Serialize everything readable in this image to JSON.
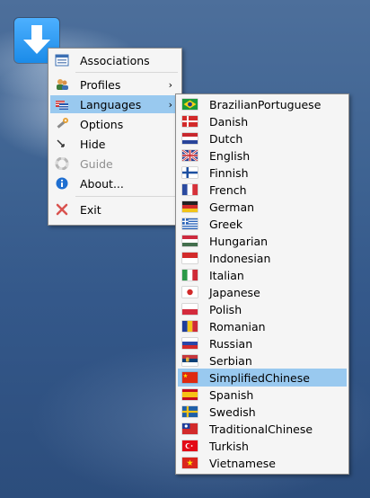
{
  "app_icon": {
    "name": "download-arrow-icon"
  },
  "main_menu": {
    "items": [
      {
        "label": "Associations",
        "icon": "associations-icon"
      },
      {
        "label": "Profiles",
        "icon": "profiles-icon"
      },
      {
        "label": "Languages",
        "icon": "languages-icon"
      },
      {
        "label": "Options",
        "icon": "wrench-icon"
      },
      {
        "label": "Hide",
        "icon": "hide-icon"
      },
      {
        "label": "Guide",
        "icon": "lifebuoy-icon"
      },
      {
        "label": "About...",
        "icon": "info-icon"
      },
      {
        "label": "Exit",
        "icon": "close-icon"
      }
    ]
  },
  "language_menu": {
    "items": [
      {
        "label": "BrazilianPortuguese"
      },
      {
        "label": "Danish"
      },
      {
        "label": "Dutch"
      },
      {
        "label": "English"
      },
      {
        "label": "Finnish"
      },
      {
        "label": "French"
      },
      {
        "label": "German"
      },
      {
        "label": "Greek"
      },
      {
        "label": "Hungarian"
      },
      {
        "label": "Indonesian"
      },
      {
        "label": "Italian"
      },
      {
        "label": "Japanese"
      },
      {
        "label": "Polish"
      },
      {
        "label": "Romanian"
      },
      {
        "label": "Russian"
      },
      {
        "label": "Serbian"
      },
      {
        "label": "SimplifiedChinese"
      },
      {
        "label": "Spanish"
      },
      {
        "label": "Swedish"
      },
      {
        "label": "TraditionalChinese"
      },
      {
        "label": "Turkish"
      },
      {
        "label": "Vietnamese"
      }
    ]
  }
}
